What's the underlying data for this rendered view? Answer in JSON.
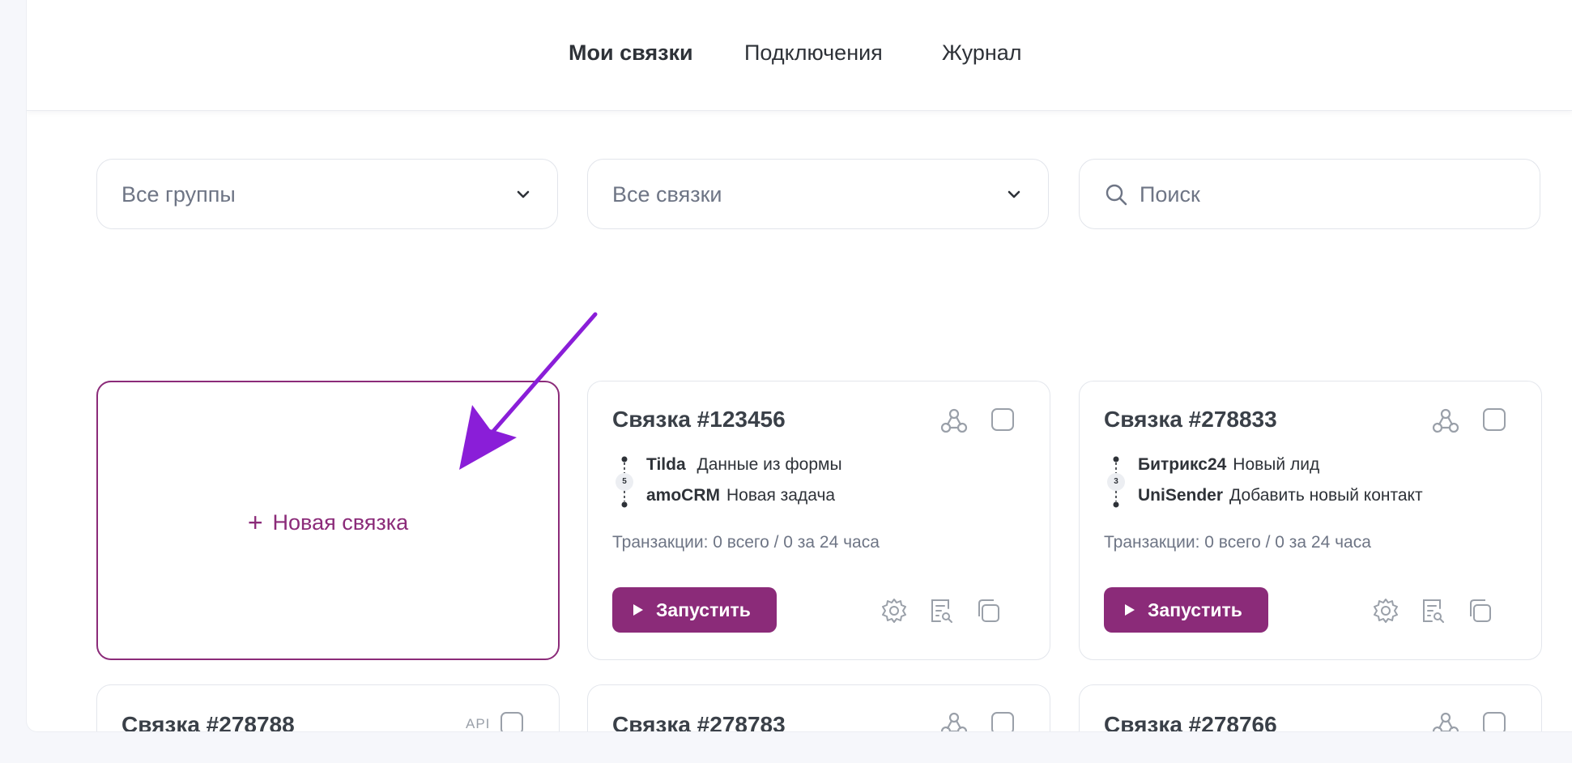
{
  "nav": {
    "tabs": [
      {
        "label": "Мои связки",
        "active": true
      },
      {
        "label": "Подключения",
        "active": false
      },
      {
        "label": "Журнал",
        "active": false
      }
    ]
  },
  "filters": {
    "groups": {
      "value": "Все группы",
      "icon": "chevron-down-icon"
    },
    "links": {
      "value": "Все связки",
      "icon": "chevron-down-icon"
    },
    "search": {
      "placeholder": "Поиск",
      "icon": "search-icon"
    }
  },
  "new_card": {
    "label": "Новая связка"
  },
  "cards": [
    {
      "title": "Связка #123456",
      "steps_count": "5",
      "source": {
        "service": "Tilda",
        "event": "Данные из формы"
      },
      "target": {
        "service": "amoCRM",
        "event": "Новая задача"
      },
      "transactions": "Транзакции: 0 всего / 0 за 24 часа",
      "run_label": "Запустить"
    },
    {
      "title": "Связка #278833",
      "steps_count": "3",
      "source": {
        "service": "Битрикс24",
        "event": "Новый лид"
      },
      "target": {
        "service": "UniSender",
        "event": "Добавить новый контакт"
      },
      "transactions": "Транзакции: 0 всего / 0 за 24 часа",
      "run_label": "Запустить"
    }
  ],
  "partial_cards": [
    {
      "title": "Связка #278788",
      "tag": "API"
    },
    {
      "title": "Связка #278783"
    },
    {
      "title": "Связка #278766"
    }
  ],
  "colors": {
    "accent": "#8b2b79",
    "annotation_arrow": "#8a1ed8"
  }
}
